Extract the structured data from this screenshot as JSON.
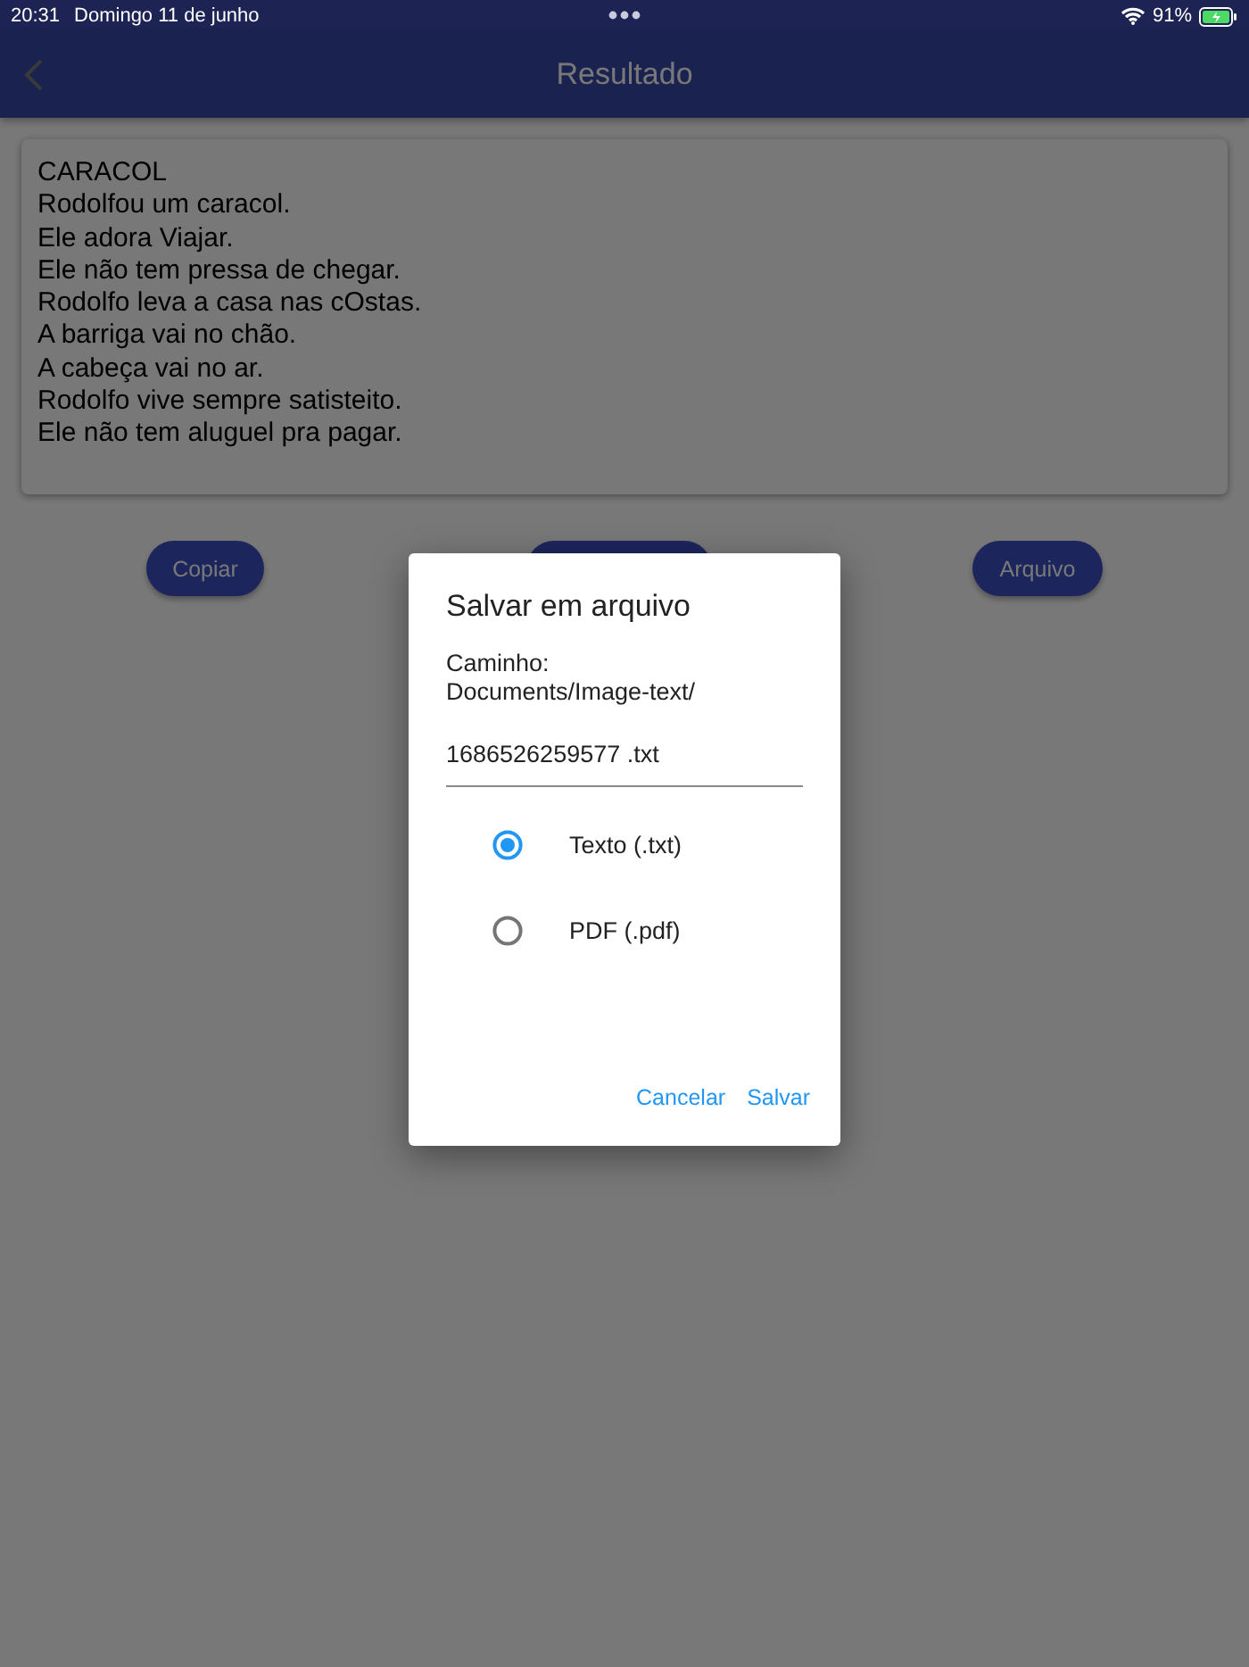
{
  "status_bar": {
    "time": "20:31",
    "date": "Domingo 11 de junho",
    "battery": "91%"
  },
  "header": {
    "title": "Resultado"
  },
  "result_text": {
    "lines": [
      "CARACOL",
      "Rodolfou um caracol.",
      "Ele adora Viajar.",
      "Ele não tem pressa de chegar.",
      "Rodolfo leva a casa nas cOstas.",
      "A barriga vai no chão.",
      "A cabeça vai no ar.",
      "Rodolfo vive sempre satisteito.",
      "Ele não tem aluguel pra pagar."
    ]
  },
  "actions": [
    {
      "kind": "labeled",
      "label": "Copiar"
    },
    {
      "kind": "covered"
    },
    {
      "kind": "labeled",
      "label": "Arquivo"
    }
  ],
  "dialog": {
    "title": "Salvar em arquivo",
    "path_label": "Caminho:",
    "path": "Documents/Image-text/",
    "filename": "1686526259577 .txt",
    "options": [
      {
        "label": "Texto (.txt)",
        "selected": true
      },
      {
        "label": "PDF (.pdf)",
        "selected": false
      }
    ],
    "buttons": [
      "Cancelar",
      "Salvar"
    ]
  }
}
